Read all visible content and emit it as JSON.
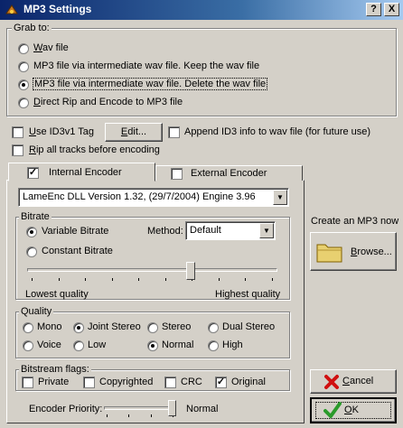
{
  "window": {
    "title": "MP3 Settings",
    "help_button": "?",
    "close_button": "X"
  },
  "grab_to": {
    "legend": "Grab to:",
    "options": [
      {
        "label": "Wav file",
        "selected": false
      },
      {
        "label": "MP3 file via intermediate wav file. Keep the wav file",
        "selected": false
      },
      {
        "label": "MP3 file via intermediate wav file. Delete the wav file",
        "selected": true
      },
      {
        "label": "Direct Rip and Encode to MP3 file",
        "selected": false
      }
    ]
  },
  "id3": {
    "use_id3v1_label": "Use ID3v1 Tag",
    "use_id3v1_checked": false,
    "edit_button": "Edit...",
    "append_label": "Append ID3 info to wav file (for future use)",
    "append_checked": false,
    "rip_all_label": "Rip all tracks before encoding",
    "rip_all_checked": false
  },
  "tabs": [
    {
      "label": "Internal Encoder",
      "checked": true,
      "active": true
    },
    {
      "label": "External Encoder",
      "checked": false,
      "active": false
    }
  ],
  "encoder": {
    "selected": "LameEnc DLL Version 1.32, (29/7/2004) Engine 3.96"
  },
  "bitrate": {
    "legend": "Bitrate",
    "variable_label": "Variable Bitrate",
    "variable_selected": true,
    "constant_label": "Constant Bitrate",
    "constant_selected": false,
    "method_label": "Method:",
    "method_value": "Default",
    "slider_position": 0.66,
    "low_label": "Lowest quality",
    "high_label": "Highest quality"
  },
  "quality": {
    "legend": "Quality",
    "options": [
      {
        "label": "Mono",
        "selected": false
      },
      {
        "label": "Joint Stereo",
        "selected": true
      },
      {
        "label": "Stereo",
        "selected": false
      },
      {
        "label": "Dual Stereo",
        "selected": false
      },
      {
        "label": "Voice",
        "selected": false
      },
      {
        "label": "Low",
        "selected": false
      },
      {
        "label": "Normal",
        "selected": true
      },
      {
        "label": "High",
        "selected": false
      }
    ]
  },
  "bitstream": {
    "legend": "Bitstream flags:",
    "flags": [
      {
        "label": "Private",
        "checked": false
      },
      {
        "label": "Copyrighted",
        "checked": false
      },
      {
        "label": "CRC",
        "checked": false
      },
      {
        "label": "Original",
        "checked": true
      }
    ]
  },
  "priority": {
    "label": "Encoder Priority:",
    "value": "Normal",
    "slider_position": 1.0
  },
  "side": {
    "create_label": "Create an MP3 now",
    "browse_button": "Browse...",
    "cancel_button": "Cancel",
    "ok_button": "OK"
  },
  "colors": {
    "titlebar_start": "#0a246a",
    "titlebar_end": "#a6caf0",
    "face": "#d4d0c8",
    "cancel_icon": "#d01010",
    "ok_icon": "#2a9a2a",
    "folder_icon": "#e8d070"
  }
}
